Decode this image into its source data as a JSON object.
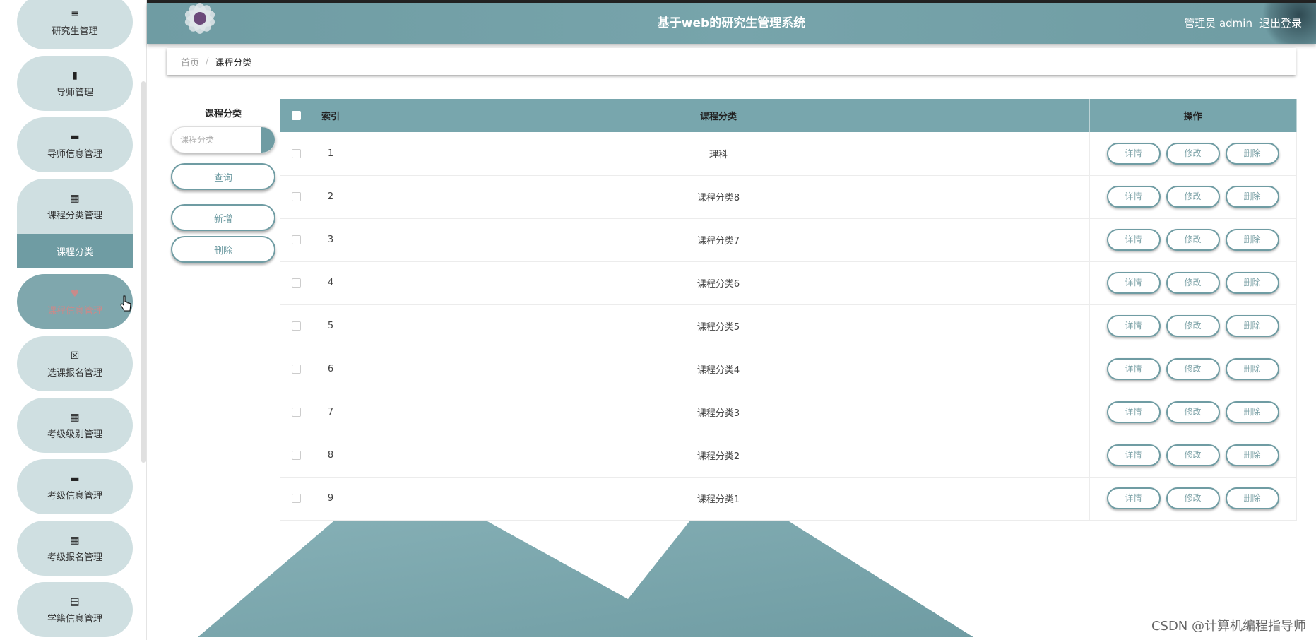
{
  "app": {
    "title": "基于web的研究生管理系统",
    "user_label": "管理员 admin",
    "logout_label": "退出登录"
  },
  "sidebar": {
    "items": [
      {
        "label": "研究生管理",
        "icon": "≡"
      },
      {
        "label": "导师管理",
        "icon": "▮"
      },
      {
        "label": "导师信息管理",
        "icon": "▬"
      },
      {
        "label": "课程分类管理",
        "icon": "▦"
      },
      {
        "label": "课程信息管理",
        "icon": "♥"
      },
      {
        "label": "选课报名管理",
        "icon": "☒"
      },
      {
        "label": "考级级别管理",
        "icon": "▦"
      },
      {
        "label": "考级信息管理",
        "icon": "▬"
      },
      {
        "label": "考级报名管理",
        "icon": "▦"
      },
      {
        "label": "学籍信息管理",
        "icon": "▤"
      }
    ],
    "active_sub": "课程分类"
  },
  "breadcrumb": {
    "home": "首页",
    "separator": "/",
    "current": "课程分类"
  },
  "filter": {
    "label": "课程分类",
    "placeholder": "课程分类",
    "query_label": "查询",
    "add_label": "新增",
    "delete_label": "删除"
  },
  "table": {
    "headers": {
      "index": "索引",
      "category": "课程分类",
      "ops": "操作"
    },
    "op_labels": {
      "detail": "详情",
      "edit": "修改",
      "delete": "删除"
    },
    "rows": [
      {
        "index": "1",
        "category": "理科"
      },
      {
        "index": "2",
        "category": "课程分类8"
      },
      {
        "index": "3",
        "category": "课程分类7"
      },
      {
        "index": "4",
        "category": "课程分类6"
      },
      {
        "index": "5",
        "category": "课程分类5"
      },
      {
        "index": "6",
        "category": "课程分类4"
      },
      {
        "index": "7",
        "category": "课程分类3"
      },
      {
        "index": "8",
        "category": "课程分类2"
      },
      {
        "index": "9",
        "category": "课程分类1"
      }
    ]
  },
  "watermark": "CSDN @计算机编程指导师",
  "colors": {
    "accent": "#6f9ca3",
    "header_bg": "#78a6ad",
    "menu_bg": "#cfdfe1"
  }
}
